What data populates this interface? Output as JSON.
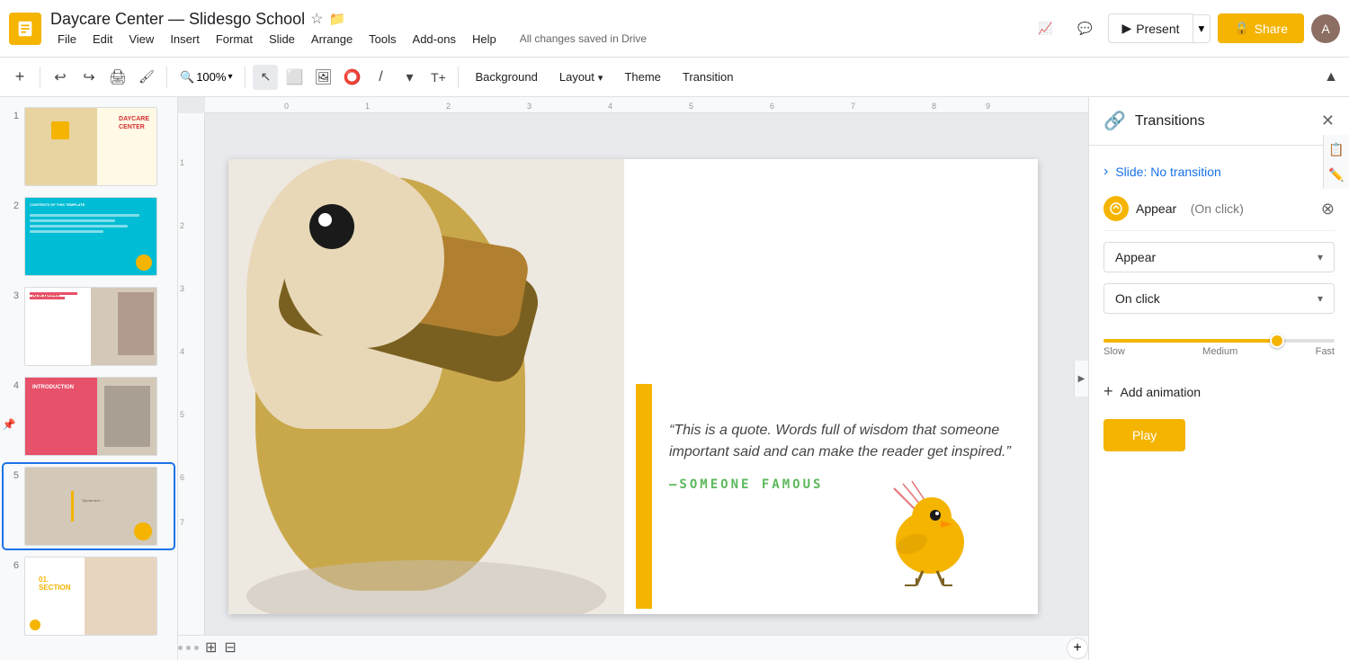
{
  "app": {
    "icon_label": "Slides",
    "title": "Daycare Center — Slidesgo School",
    "star_icon": "☆",
    "folder_icon": "📁",
    "save_status": "All changes saved in Drive"
  },
  "menu": {
    "items": [
      "File",
      "Edit",
      "View",
      "Insert",
      "Format",
      "Slide",
      "Arrange",
      "Tools",
      "Add-ons",
      "Help"
    ]
  },
  "toolbar": {
    "zoom_level": "100%",
    "background_label": "Background",
    "layout_label": "Layout",
    "theme_label": "Theme",
    "transition_label": "Transition"
  },
  "header_buttons": {
    "present_label": "Present",
    "share_label": "Share",
    "share_icon": "🔒"
  },
  "slides": [
    {
      "num": "1",
      "active": false
    },
    {
      "num": "2",
      "active": false
    },
    {
      "num": "3",
      "active": false
    },
    {
      "num": "4",
      "active": false
    },
    {
      "num": "5",
      "active": true
    },
    {
      "num": "6",
      "active": false
    }
  ],
  "slide_content": {
    "quote": "“This is a quote. Words full of wisdom that someone important said and can make the reader get inspired.”",
    "attribution": "—SOMEONE FAMOUS"
  },
  "transitions_panel": {
    "title": "Transitions",
    "slide_transition_label": "Slide: No transition",
    "animation_label": "Appear  (On click)",
    "appear_option": "Appear",
    "on_click_option": "On click",
    "speed": {
      "slow_label": "Slow",
      "medium_label": "Medium",
      "fast_label": "Fast",
      "value": 75
    },
    "add_animation_label": "Add animation",
    "play_label": "Play"
  }
}
